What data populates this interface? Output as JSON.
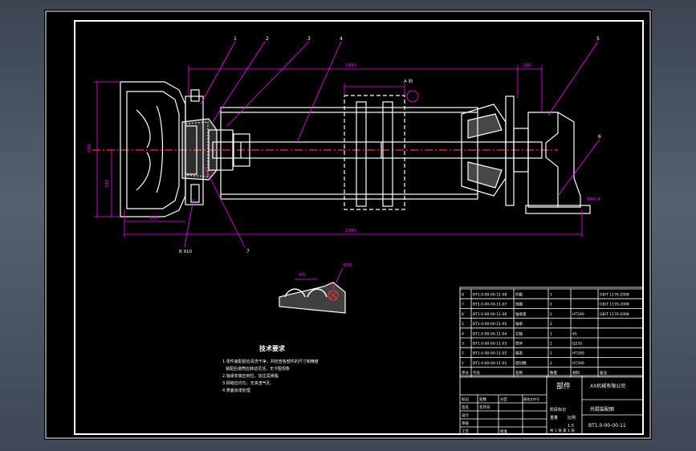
{
  "drawing": {
    "tech_title": "技术要求",
    "tech_notes": [
      "1.零件装配前应清洗干净，并检查各部件的尺寸和精度",
      "装配后滚筒应转动灵活，无卡阻现象",
      "2.轴承安装应到位，加注润滑脂",
      "3.焊缝应均匀，无夹渣气孔",
      "4.表面涂漆处理"
    ],
    "leader_numbers": [
      "1",
      "2",
      "3",
      "4",
      "5",
      "6",
      "7"
    ],
    "dims": {
      "top_span": "1890",
      "top_right": "180",
      "bottom_span": "2380",
      "bottom_left": "100",
      "left_h1": "680",
      "left_h2": "310",
      "right_note": "Φ48.4",
      "section_label": "A 向",
      "view_label": "B 910"
    },
    "detail": {
      "label_left": "R5",
      "label_right": "Φ36"
    }
  },
  "title_block": {
    "part_name": "部件",
    "company": "XX机械有限公司",
    "assembly_name": "托辊装配图",
    "drawing_no": "BT1.0-00-00-11",
    "header_cells": [
      "序号",
      "代号",
      "名称",
      "数量",
      "材料",
      "备注"
    ],
    "bom_rows": [
      [
        "8",
        "BT1.0-00-00-11-08",
        "托辊",
        "1",
        "",
        "GB/T 1176-2008"
      ],
      [
        "7",
        "BT1.0-00-00-11-07",
        "挡圈",
        "2",
        "",
        "GB/T 1176-2008"
      ],
      [
        "6",
        "BT1.0-00-00-11-06",
        "轴承座",
        "2",
        "HT200",
        "GB/T 1176-2008"
      ],
      [
        "5",
        "BT1.0-00-00-11-05",
        "轴承",
        "2",
        "",
        ""
      ],
      [
        "4",
        "BT1.0-00-00-11-04",
        "芯轴",
        "1",
        "45",
        ""
      ],
      [
        "3",
        "BT1.0-00-00-11-03",
        "筒体",
        "1",
        "Q235",
        ""
      ],
      [
        "2",
        "BT1.0-00-00-11-02",
        "端盖",
        "2",
        "HT200",
        ""
      ],
      [
        "1",
        "BT1.0-00-00-11-01",
        "密封圈",
        "2",
        "HT200",
        ""
      ]
    ],
    "sign_cells": [
      "标记",
      "处数",
      "分区",
      "更改文件号",
      "签名",
      "年月日"
    ],
    "role_cells": [
      "设计",
      "审核",
      "工艺",
      "批准"
    ],
    "stage_cells": [
      "阶段标记",
      "重量",
      "比例"
    ],
    "scale": "1:5",
    "sheet_info": "共 1 张  第 1 张"
  }
}
